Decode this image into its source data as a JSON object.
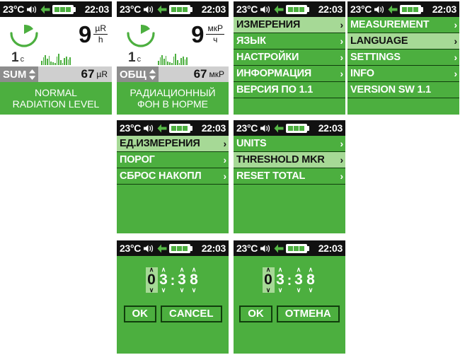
{
  "statusbar": {
    "temperature": "23°C",
    "time": "22:03",
    "speaker_icon": "speaker-icon",
    "arrow_icon": "left-arrow-icon",
    "battery_icon": "battery-icon",
    "battery_cells": 3
  },
  "colors": {
    "screen_green": "#4caf3f",
    "highlight_green": "#a6d996",
    "statusbar_black": "#111111",
    "sum_label_gray": "#8d8d8d",
    "sum_value_gray": "#cfcfcf",
    "white": "#ffffff"
  },
  "measurement_en": {
    "dose_value": "9",
    "dose_unit_numerator": "µR",
    "dose_unit_denominator": "h",
    "interval_value": "1",
    "interval_unit": "c",
    "total_label": "SUM",
    "total_value": "67",
    "total_unit": "µR",
    "banner_line1": "NORMAL",
    "banner_line2": "RADIATION LEVEL"
  },
  "measurement_ru": {
    "dose_value": "9",
    "dose_unit_numerator": "мкР",
    "dose_unit_denominator": "ч",
    "interval_value": "1",
    "interval_unit": "c",
    "total_label": "ОБЩ",
    "total_value": "67",
    "total_unit": "мкР",
    "banner_line1": "РАДИАЦИОННЫЙ",
    "banner_line2": "ФОН В НОРМЕ"
  },
  "histogram": {
    "bars": [
      6,
      11,
      14,
      9,
      13,
      5,
      4,
      3,
      12,
      16,
      7,
      3,
      10,
      12,
      8,
      11
    ]
  },
  "main_menu_ru": {
    "items": [
      {
        "label": "ИЗМЕРЕНИЯ",
        "chevron": "›",
        "selected": true
      },
      {
        "label": "ЯЗЫК",
        "chevron": "›",
        "selected": false
      },
      {
        "label": "НАСТРОЙКИ",
        "chevron": "›",
        "selected": false
      },
      {
        "label": "ИНФОРМАЦИЯ",
        "chevron": "›",
        "selected": false
      },
      {
        "label": "ВЕРСИЯ ПО 1.1",
        "chevron": "",
        "selected": false
      }
    ]
  },
  "main_menu_en": {
    "items": [
      {
        "label": "MEASUREMENT",
        "chevron": "›",
        "selected": false
      },
      {
        "label": "LANGUAGE",
        "chevron": "›",
        "selected": true
      },
      {
        "label": "SETTINGS",
        "chevron": "›",
        "selected": false
      },
      {
        "label": "INFO",
        "chevron": "›",
        "selected": false
      },
      {
        "label": "VERSION SW 1.1",
        "chevron": "",
        "selected": false
      }
    ]
  },
  "settings_menu_ru": {
    "items": [
      {
        "label": "ЕД.ИЗМЕРЕНИЯ",
        "chevron": "›",
        "selected": true
      },
      {
        "label": "ПОРОГ",
        "chevron": "›",
        "selected": false
      },
      {
        "label": "СБРОС НАКОПЛ",
        "chevron": "›",
        "selected": false
      }
    ]
  },
  "settings_menu_en": {
    "items": [
      {
        "label": "UNITS",
        "chevron": "›",
        "selected": false
      },
      {
        "label": "THRESHOLD MKR",
        "chevron": "›",
        "selected": true
      },
      {
        "label": "RESET TOTAL",
        "chevron": "›",
        "selected": false
      }
    ]
  },
  "time_setter_en": {
    "digits": [
      "0",
      "3",
      "3",
      "8"
    ],
    "selected_index": 0,
    "separator": ":",
    "up_chevron": "∧",
    "down_chevron": "∨",
    "ok_label": "OK",
    "cancel_label": "CANCEL"
  },
  "time_setter_ru": {
    "digits": [
      "0",
      "3",
      "3",
      "8"
    ],
    "selected_index": 0,
    "separator": ":",
    "up_chevron": "∧",
    "down_chevron": "∨",
    "ok_label": "OK",
    "cancel_label": "ОТМЕНА"
  }
}
